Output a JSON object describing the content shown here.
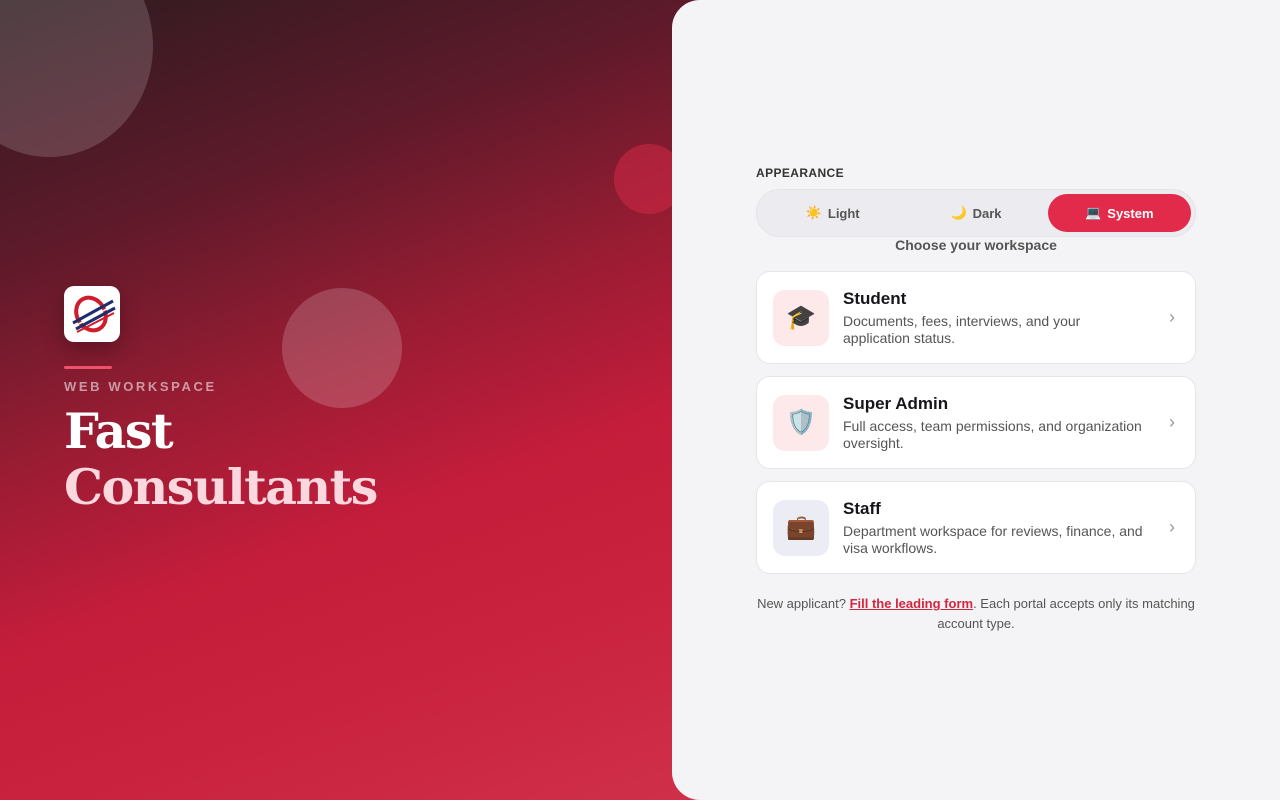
{
  "hero": {
    "eyebrow": "WEB WORKSPACE",
    "brand_line_1": "Fast",
    "brand_line_2": "Consultants",
    "logo_icon": "fast-consultants-logo"
  },
  "appearance": {
    "label": "APPEARANCE",
    "options": [
      {
        "icon": "☀️",
        "label": "Light",
        "active": false
      },
      {
        "icon": "🌙",
        "label": "Dark",
        "active": false
      },
      {
        "icon": "💻",
        "label": "System",
        "active": true
      }
    ]
  },
  "workspace": {
    "heading": "Choose your workspace",
    "cards": [
      {
        "icon": "🎓",
        "icon_name": "graduation-cap-icon",
        "title": "Student",
        "description": "Documents, fees, interviews, and your application status."
      },
      {
        "icon": "🛡️",
        "icon_name": "shield-icon",
        "title": "Super Admin",
        "description": "Full access, team permissions, and organization oversight."
      },
      {
        "icon": "💼",
        "icon_name": "briefcase-icon",
        "title": "Staff",
        "description": "Department workspace for reviews, finance, and visa workflows."
      }
    ]
  },
  "footer": {
    "prefix": "New applicant? ",
    "link": "Fill the leading form",
    "suffix": ". Each portal accepts only its matching account type."
  },
  "colors": {
    "accent": "#e22a4a",
    "link": "#d6263f",
    "panel_bg": "#f4f4f6"
  }
}
